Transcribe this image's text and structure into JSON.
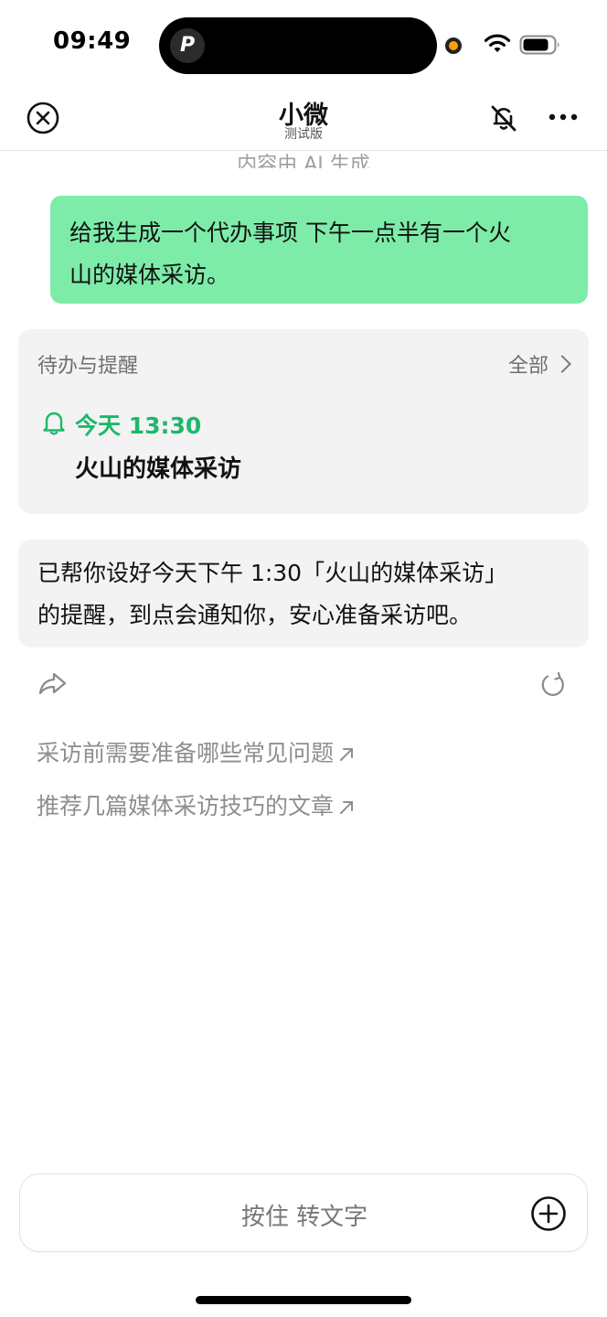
{
  "status_bar": {
    "time": "09:49",
    "island_app_glyph": "P"
  },
  "nav": {
    "title": "小微",
    "subtitle": "测试版",
    "icons": [
      "close-circle-icon",
      "mute-icon",
      "more-icon"
    ]
  },
  "chat": {
    "ai_note": "内容由 AI 生成",
    "user_message_lines": [
      "给我生成一个代办事项 下午一点半有一个火",
      "山的媒体采访。"
    ],
    "todo_card": {
      "title": "待办与提醒",
      "all_label": "全部",
      "time": "今天 13:30",
      "task": "火山的媒体采访",
      "accent_color": "#1db86a"
    },
    "ai_reply_lines": [
      "已帮你设好今天下午 1:30「火山的媒体采访」",
      "的提醒，到点会通知你，安心准备采访吧。"
    ],
    "suggestions": [
      {
        "label": "采访前需要准备哪些常见问题"
      },
      {
        "label": "推荐几篇媒体采访技巧的文章"
      }
    ]
  },
  "input": {
    "hold_to_talk_label": "按住 转文字"
  },
  "colors": {
    "user_bubble": "#7eeca9",
    "card_bg": "#f3f3f3"
  }
}
